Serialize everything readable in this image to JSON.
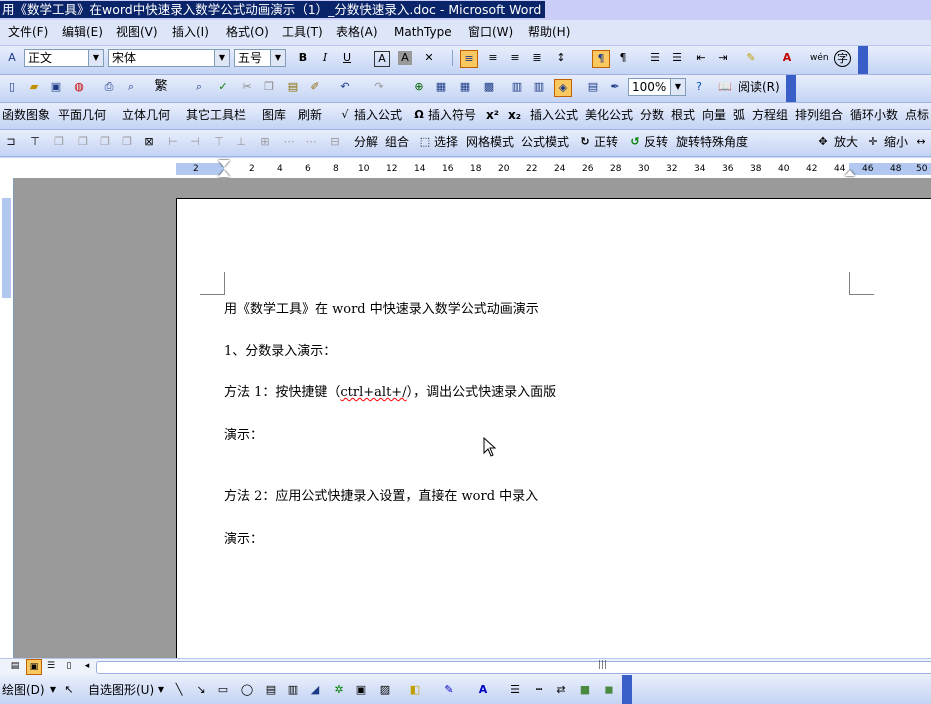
{
  "window": {
    "title": "用《数学工具》在word中快速录入数学公式动画演示（1）_分数快速录入.doc - Microsoft Word"
  },
  "menu": [
    "文件(F)",
    "编辑(E)",
    "视图(V)",
    "插入(I)",
    "格式(O)",
    "工具(T)",
    "表格(A)",
    "MathType",
    "窗口(W)",
    "帮助(H)"
  ],
  "format_toolbar": {
    "style_value": "正文",
    "font_value": "宋体",
    "size_value": "五号",
    "bold": "B",
    "italic": "I",
    "underline": "U",
    "char_border": "A",
    "char_shading": "A",
    "phonetic": "wén",
    "enclose": "字"
  },
  "standard_toolbar": {
    "traditional": "繁",
    "zoom_value": "100%",
    "read_label": "阅读(R)"
  },
  "math_toolbar1": [
    "函数图象",
    "平面几何",
    "立体几何",
    "其它工具栏",
    "图库",
    "刷新",
    "插入公式",
    "插入符号",
    "x²",
    "x₂",
    "插入公式",
    "美化公式",
    "分数",
    "根式",
    "向量",
    "弧",
    "方程组",
    "排列组合",
    "循环小数",
    "点标"
  ],
  "math_toolbar2": [
    "分解",
    "组合",
    "选择",
    "网格模式",
    "公式模式",
    "正转",
    "反转",
    "旋转特殊角度",
    "放大",
    "缩小"
  ],
  "ruler": {
    "numbers": [
      "2",
      "2",
      "4",
      "6",
      "8",
      "10",
      "12",
      "14",
      "16",
      "18",
      "20",
      "22",
      "24",
      "26",
      "28",
      "30",
      "32",
      "34",
      "36",
      "38",
      "40",
      "42",
      "44",
      "46",
      "48",
      "50"
    ]
  },
  "document": {
    "lines": [
      "用《数学工具》在 word 中快速录入数学公式动画演示",
      "1、分数录入演示：",
      "方法 1：按快捷键（",
      "ctrl+alt+/",
      "），调出公式快速录入面版",
      "演示：",
      "方法 2：应用公式快捷录入设置，直接在 word 中录入",
      "演示："
    ]
  },
  "drawing_toolbar": {
    "draw_label": "绘图(D)",
    "autoshape_label": "自选图形(U)"
  },
  "colors": {
    "title_highlight": "#0a246a",
    "toolbar_end": "#3a5ec8",
    "ruler_blue": "#b3c8f0"
  }
}
